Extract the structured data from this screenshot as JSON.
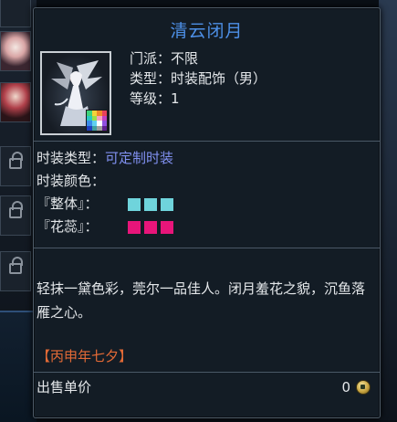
{
  "tooltip": {
    "title": "清云闭月",
    "sect_line": "门派：不限",
    "type_line": "类型：时装配饰（男）",
    "level_line": "等级：1",
    "fashion_type_label": "时装类型：",
    "fashion_type_value": "可定制时装",
    "fashion_color_label": "时装颜色：",
    "color_rows": [
      {
        "label": "『整体』：",
        "color": "#6fd4dc"
      },
      {
        "label": "『花蕊』：",
        "color": "#e8157a"
      }
    ],
    "description": "轻抹一黛色彩，莞尔一品佳人。闭月羞花之貌，沉鱼落雁之心。",
    "origin": "【丙申年七夕】",
    "price_label": "出售单价",
    "price_value": "0"
  },
  "colors": {
    "title": "#4d8fe6",
    "fashion_type_value": "#8090f0",
    "origin": "#e36a36"
  },
  "icons": [
    "item-portrait-icon",
    "color-badge-icon",
    "coin-icon",
    "lock-icon"
  ]
}
